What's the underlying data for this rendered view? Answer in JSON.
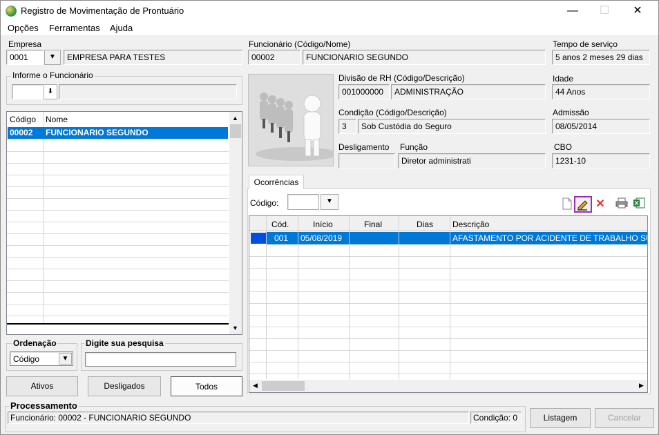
{
  "window": {
    "title": "Registro de Movimentação de Prontuário",
    "minimize": "—",
    "maximize": "☐",
    "close": "✕"
  },
  "menu": [
    "Opções",
    "Ferramentas",
    "Ajuda"
  ],
  "empresa": {
    "label": "Empresa",
    "code": "0001",
    "name": "EMPRESA PARA TESTES"
  },
  "informe": {
    "label": "Informe o Funcionário",
    "value": "",
    "btn": "⬇"
  },
  "list": {
    "headers": [
      "Código",
      "Nome"
    ],
    "rows": [
      {
        "code": "00002",
        "name": "FUNCIONARIO SEGUNDO"
      }
    ]
  },
  "ordenacao": {
    "label": "Ordenação",
    "value": "Código"
  },
  "pesquisa": {
    "label": "Digite sua pesquisa",
    "value": ""
  },
  "filter_buttons": {
    "ativos": "Ativos",
    "desligados": "Desligados",
    "todos": "Todos"
  },
  "funcionario": {
    "label": "Funcionário (Código/Nome)",
    "code": "00002",
    "name": "FUNCIONARIO SEGUNDO"
  },
  "tempo": {
    "label": "Tempo de serviço",
    "value": "5 anos 2 meses 29 dias"
  },
  "divisao": {
    "label": "Divisão de RH (Código/Descrição)",
    "code": "001000000",
    "desc": "ADMINISTRAÇÃO"
  },
  "idade": {
    "label": "Idade",
    "value": "44 Anos"
  },
  "condicao": {
    "label": "Condição (Código/Descrição)",
    "code": "3",
    "desc": "Sob Custódia do Seguro"
  },
  "admissao": {
    "label": "Admissão",
    "value": "08/05/2014"
  },
  "desligamento": {
    "label": "Desligamento",
    "value": ""
  },
  "funcao": {
    "label": "Função",
    "value": "Diretor administrati"
  },
  "cbo": {
    "label": "CBO",
    "value": "1231-10"
  },
  "tab": {
    "label": "Ocorrências"
  },
  "codigo": {
    "label": "Código:",
    "value": ""
  },
  "occ": {
    "headers": [
      "Cód.",
      "Início",
      "Final",
      "Dias",
      "Descrição"
    ],
    "rows": [
      {
        "cod": "001",
        "inicio": "05/08/2019",
        "final": "",
        "dias": "",
        "desc": "AFASTAMENTO POR ACIDENTE DE TRABALHO SUPER"
      }
    ]
  },
  "processamento": {
    "label": "Processamento",
    "status": "Funcionário: 00002 - FUNCIONARIO SEGUNDO",
    "condicao": "Condição: 0"
  },
  "bottom_buttons": {
    "listagem": "Listagem",
    "cancelar": "Cancelar"
  },
  "colors": {
    "selection": "#0078d7",
    "highlight_border": "#9b30b0"
  }
}
